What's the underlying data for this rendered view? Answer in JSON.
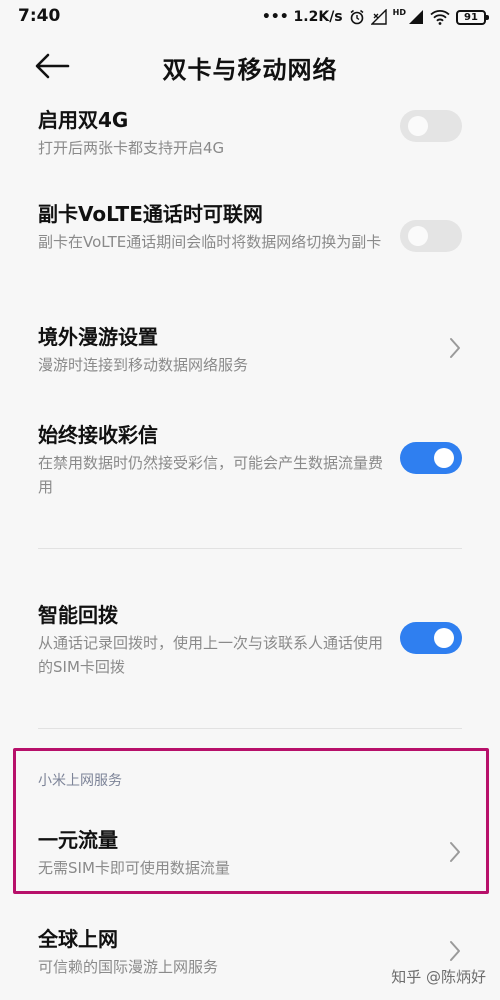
{
  "status_bar": {
    "time": "7:40",
    "network_speed": "••• 1.2K/s",
    "signal_label": "HD",
    "battery": "91"
  },
  "header": {
    "title": "双卡与移动网络"
  },
  "settings": {
    "dual_4g": {
      "title": "启用双4G",
      "desc": "打开后两张卡都支持开启4G",
      "enabled": false
    },
    "volte": {
      "title": "副卡VoLTE通话时可联网",
      "desc": "副卡在VoLTE通话期间会临时将数据网络切换为副卡",
      "enabled": false
    },
    "roaming": {
      "title": "境外漫游设置",
      "desc": "漫游时连接到移动数据网络服务"
    },
    "mms": {
      "title": "始终接收彩信",
      "desc": "在禁用数据时仍然接受彩信，可能会产生数据流量费用",
      "enabled": true
    },
    "smart_callback": {
      "title": "智能回拨",
      "desc": "从通话记录回拨时，使用上一次与该联系人通话使用的SIM卡回拨",
      "enabled": true
    }
  },
  "xiaomi_section": {
    "header": "小米上网服务",
    "one_yuan": {
      "title": "一元流量",
      "desc": "无需SIM卡即可使用数据流量"
    },
    "global_net": {
      "title": "全球上网",
      "desc": "可信赖的国际漫游上网服务"
    }
  },
  "watermark": "知乎 @陈炳好",
  "colors": {
    "toggle_on": "#2f7ff0",
    "toggle_off": "#e4e4e4",
    "highlight": "#b7106a"
  }
}
